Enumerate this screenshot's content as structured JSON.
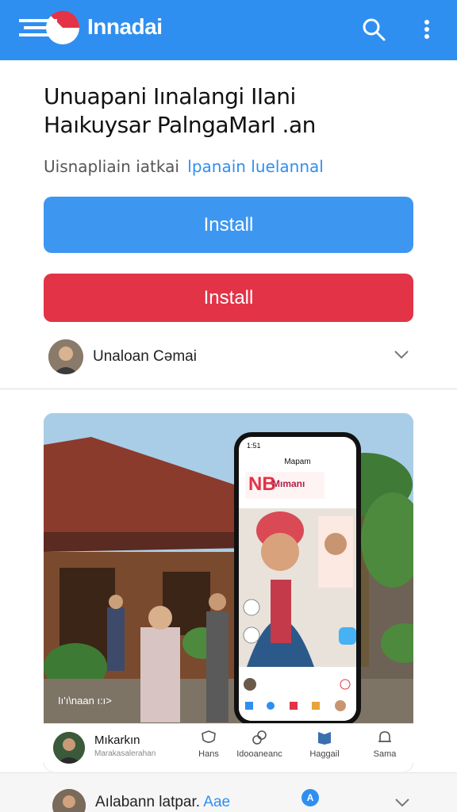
{
  "header": {
    "brand": "Innadai",
    "search_icon": "search-icon",
    "more_icon": "more-vert-icon",
    "bar_color": "#2f8ff0"
  },
  "main": {
    "title_line1": "Unuapani Iınalangi IIani",
    "title_line2": "Haıkuysar PalngaMarI .an",
    "subtitle": "Uisnapliain iatkai",
    "subtitle_link": "lpanain luelannal",
    "install_primary": "Install",
    "install_secondary": "Install",
    "developer_name": "Unaloan Cəmai"
  },
  "hero": {
    "caption": "Iı'ı\\naan   ı:ı>",
    "phone": {
      "status_time": "1:51",
      "title": "Mapam",
      "banner_big": "NB",
      "banner_small": "Mımanı"
    },
    "nav": {
      "profile_name": "Mıkarkın",
      "profile_sub": "Marakasalerahan",
      "items": [
        "Hans",
        "Idooaneanc",
        "Haggail",
        "Sama"
      ]
    }
  },
  "bottom": {
    "name": "Aılabann Ɩatpar.",
    "name_highlight": "Aae",
    "badge": "A"
  },
  "colors": {
    "accent": "#2f8ff0",
    "install_blue": "#3d97f1",
    "install_red": "#e33346"
  }
}
